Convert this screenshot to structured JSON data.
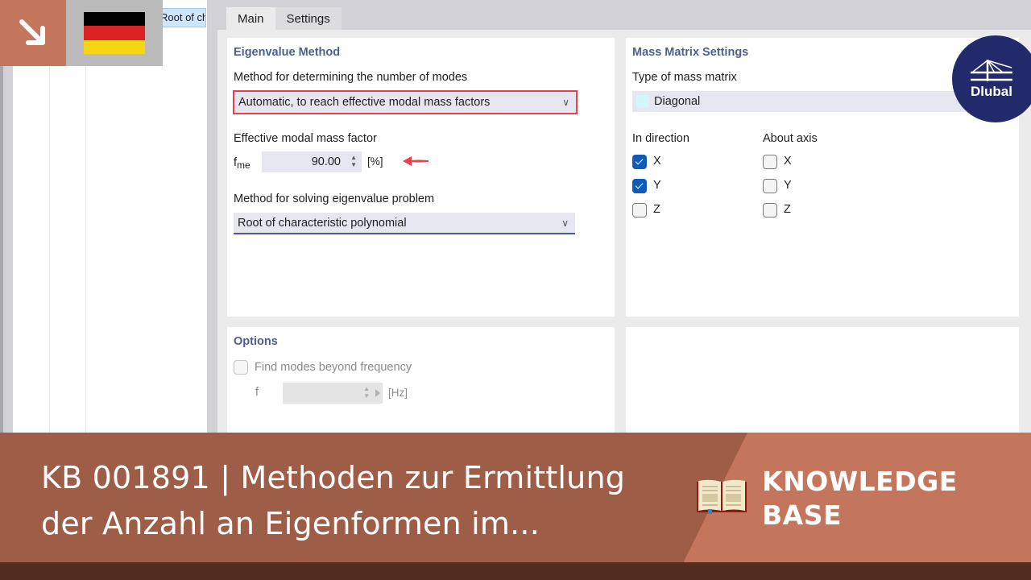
{
  "tree": {
    "selected_item": "Root of chs"
  },
  "overlay": {
    "corner_icon": "arrow-down-right-icon",
    "flag": "germany-flag",
    "flag_colors": [
      "#000000",
      "#dd2222",
      "#f6d514"
    ]
  },
  "dialog": {
    "tabs": [
      {
        "label": "Main",
        "active": true
      },
      {
        "label": "Settings",
        "active": false
      }
    ],
    "eigenvalue_method": {
      "title": "Eigenvalue Method",
      "num_modes_label": "Method for determining the number of modes",
      "num_modes_value": "Automatic, to reach effective modal mass factors",
      "mass_factor_label": "Effective modal mass factor",
      "mass_factor_symbol": "f",
      "mass_factor_subscript": "me",
      "mass_factor_value": "90.00",
      "mass_factor_unit": "[%]",
      "solve_method_label": "Method for solving eigenvalue problem",
      "solve_method_value": "Root of characteristic polynomial"
    },
    "mass_matrix": {
      "title": "Mass Matrix Settings",
      "type_label": "Type of mass matrix",
      "type_value": "Diagonal",
      "type_swatch_color": "#d4f6fb",
      "direction_label": "In direction",
      "direction_items": [
        {
          "label": "X",
          "checked": true
        },
        {
          "label": "Y",
          "checked": true
        },
        {
          "label": "Z",
          "checked": false
        }
      ],
      "axis_label": "About axis",
      "axis_items": [
        {
          "label": "X",
          "checked": false
        },
        {
          "label": "Y",
          "checked": false
        },
        {
          "label": "Z",
          "checked": false
        }
      ]
    },
    "options": {
      "title": "Options",
      "find_modes_label": "Find modes beyond frequency",
      "find_modes_checked": false,
      "frequency_symbol": "f",
      "frequency_value": "",
      "frequency_unit": "[Hz]"
    }
  },
  "logo": {
    "text": "Dlubal"
  },
  "banner": {
    "title_line1": "KB 001891 | Methoden zur Ermittlung",
    "title_line2": "der Anzahl an Eigenformen im...",
    "category_line1": "KNOWLEDGE",
    "category_line2": "BASE",
    "icon": "open-book-icon"
  },
  "colors": {
    "accent_blue": "#0f5bb8",
    "title_blue": "#4e5f8a",
    "highlight_red": "#e8414a",
    "banner_brown": "#9d5d47",
    "banner_terracotta": "#c4765c",
    "banner_dark": "#532c20",
    "logo_navy": "#232a6b"
  }
}
